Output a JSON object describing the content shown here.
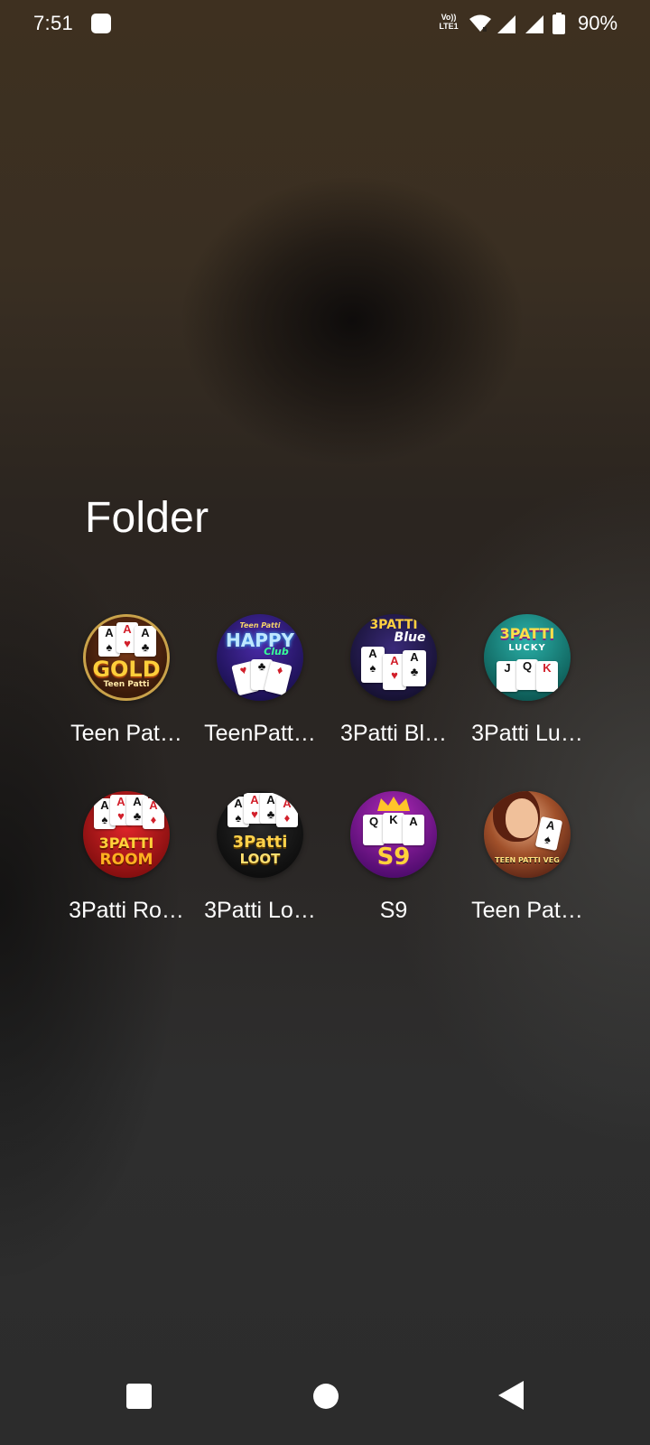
{
  "status_bar": {
    "time": "7:51",
    "network_label_top": "Vo))",
    "network_label_bottom": "LTE1",
    "battery_percent": "90%",
    "icons": [
      "notification-icon",
      "volte-icon",
      "wifi-icon",
      "signal-icon",
      "signal-icon",
      "battery-icon"
    ]
  },
  "folder": {
    "title": "Folder",
    "apps": [
      {
        "label": "Teen Pat…",
        "icon": "teen-patti-gold-icon"
      },
      {
        "label": "TeenPatt…",
        "icon": "teenpatti-happy-club-icon"
      },
      {
        "label": "3Patti Bl…",
        "icon": "3patti-blue-icon"
      },
      {
        "label": "3Patti Lu…",
        "icon": "3patti-lucky-icon"
      },
      {
        "label": "3Patti Ro…",
        "icon": "3patti-room-icon"
      },
      {
        "label": "3Patti Lo…",
        "icon": "3patti-loot-icon"
      },
      {
        "label": "S9",
        "icon": "s9-icon"
      },
      {
        "label": "Teen Pat…",
        "icon": "teen-patti-vegas-icon"
      }
    ]
  },
  "icon_text": {
    "gold": "GOLD",
    "gold_sub": "Teen Patti",
    "happy": "HAPPY",
    "happy_top": "Teen Patti",
    "happy_club": "Club",
    "blue_top": "3PATTI",
    "blue": "Blue",
    "lucky": "3PATTI",
    "lucky_sub": "LUCKY",
    "room_top": "3PATTI",
    "room": "ROOM",
    "loot_top": "3Patti",
    "loot": "LOOT",
    "s9": "S9",
    "vegas": "TEEN PATTI VEG"
  },
  "navigation": {
    "recents": "recents-button",
    "home": "home-button",
    "back": "back-button"
  },
  "colors": {
    "text": "#ffffff",
    "background_top": "#3e3020",
    "background_bottom": "#2c2c2c"
  }
}
